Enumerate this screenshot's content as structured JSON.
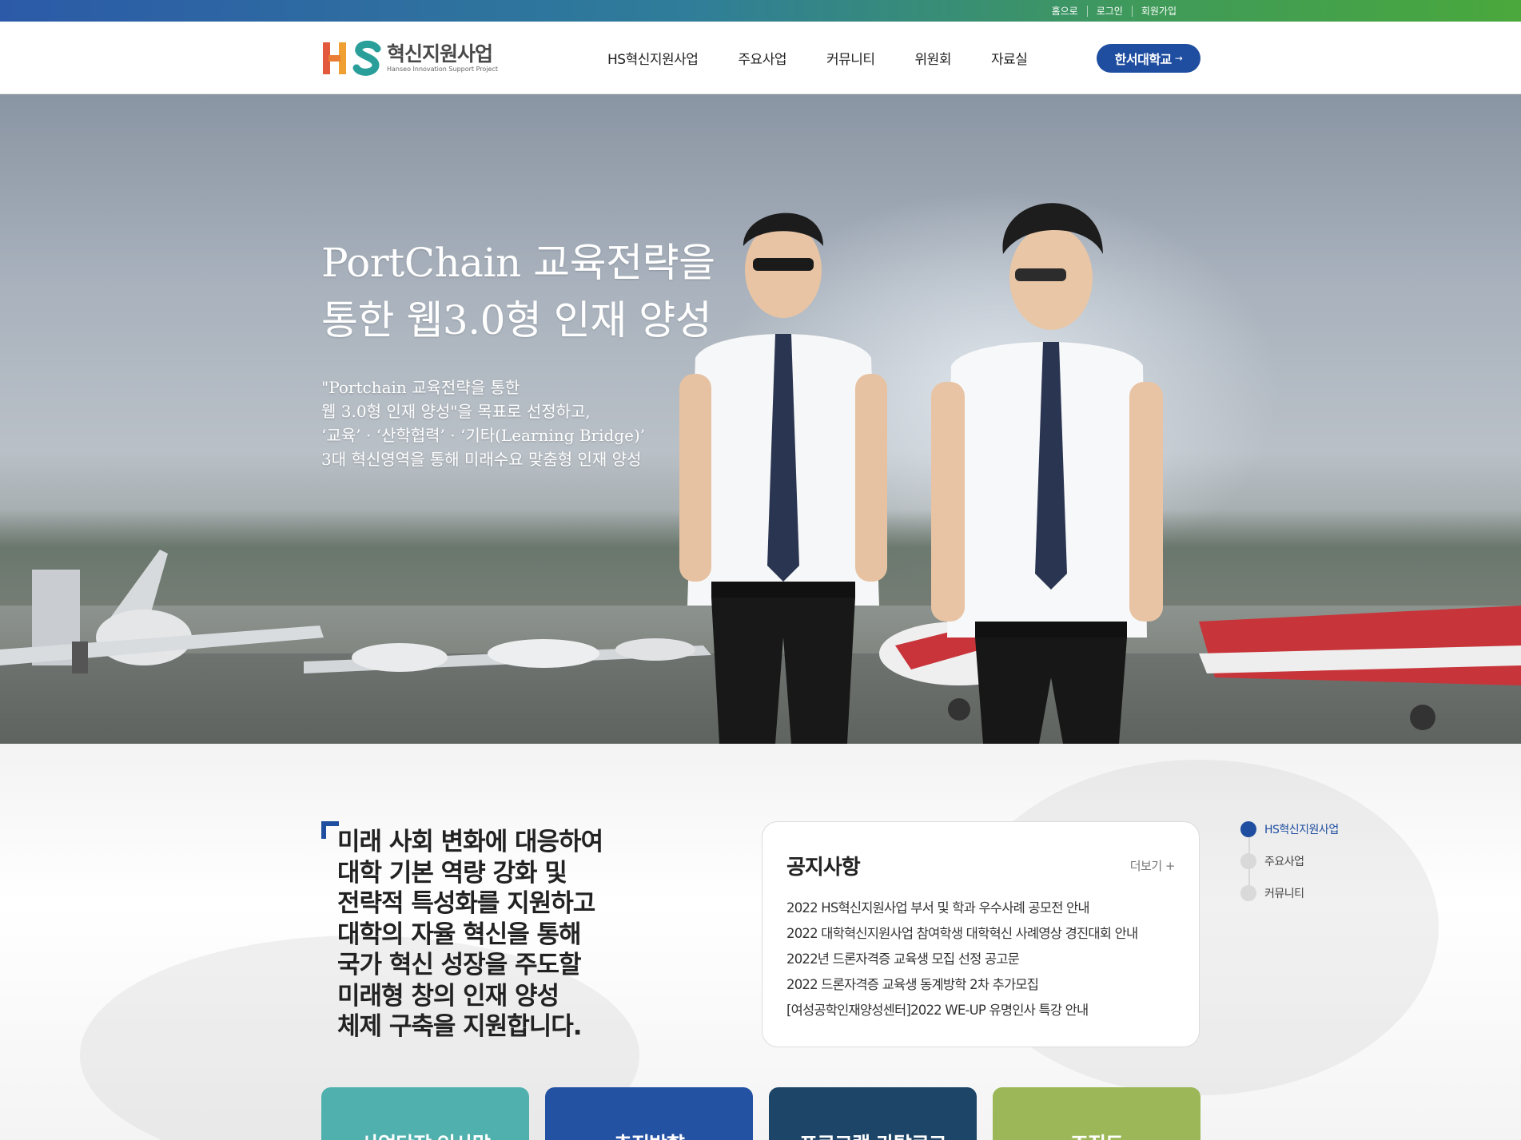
{
  "utility_nav": {
    "home": "홈으로",
    "login": "로그인",
    "signup": "회원가입"
  },
  "header": {
    "logo": {
      "letters": "HS",
      "title": "혁신지원사업",
      "subtitle": "Hanseo Innovation Support Project"
    },
    "nav": [
      "HS혁신지원사업",
      "주요사업",
      "커뮤니티",
      "위원회",
      "자료실"
    ],
    "university_button": {
      "label": "한서대학교",
      "arrow": "→"
    }
  },
  "hero": {
    "title": "PortChain 교육전략을\n통한 웹3.0형 인재 양성",
    "description": "\"Portchain 교육전략을 통한\n웹 3.0형 인재 양성\"을 목표로 선정하고,\n‘교육’ · ‘산학협력’ · ‘기타(Learning Bridge)’\n3대 혁신영역을 통해 미래수요 맞춤형 인재 양성"
  },
  "mission": {
    "text": "미래 사회 변화에 대응하여\n대학 기본 역량 강화 및\n전략적 특성화를 지원하고\n대학의 자율 혁신을 통해\n국가 혁신 성장을 주도할\n미래형 창의 인재 양성\n체제 구축을 지원합니다."
  },
  "notice": {
    "title": "공지사항",
    "more": "더보기 +",
    "items": [
      "2022 HS혁신지원사업 부서 및 학과 우수사례 공모전 안내",
      "2022 대학혁신지원사업 참여학생 대학혁신 사례영상 경진대회 안내",
      "2022년 드론자격증 교육생 모집 선정 공고문",
      "2022 드론자격증 교육생 동계방학 2차 추가모집",
      "[여성공학인재양성센터]2022 WE-UP 유명인사 특강 안내"
    ]
  },
  "side_nav": {
    "items": [
      "HS혁신지원사업",
      "주요사업",
      "커뮤니티"
    ],
    "active_index": 0
  },
  "cards": [
    {
      "label": "사업단장 인사말",
      "color": "#4fb0ad"
    },
    {
      "label": "추진방향",
      "color": "#2452a3"
    },
    {
      "label": "프로그램 카탈로그",
      "color": "#1d4567"
    },
    {
      "label": "조직도",
      "color": "#9bb758"
    }
  ],
  "colors": {
    "brand_blue": "#1f4ea1",
    "topbar_start": "#2c5aa8",
    "topbar_end": "#4aa83c"
  }
}
